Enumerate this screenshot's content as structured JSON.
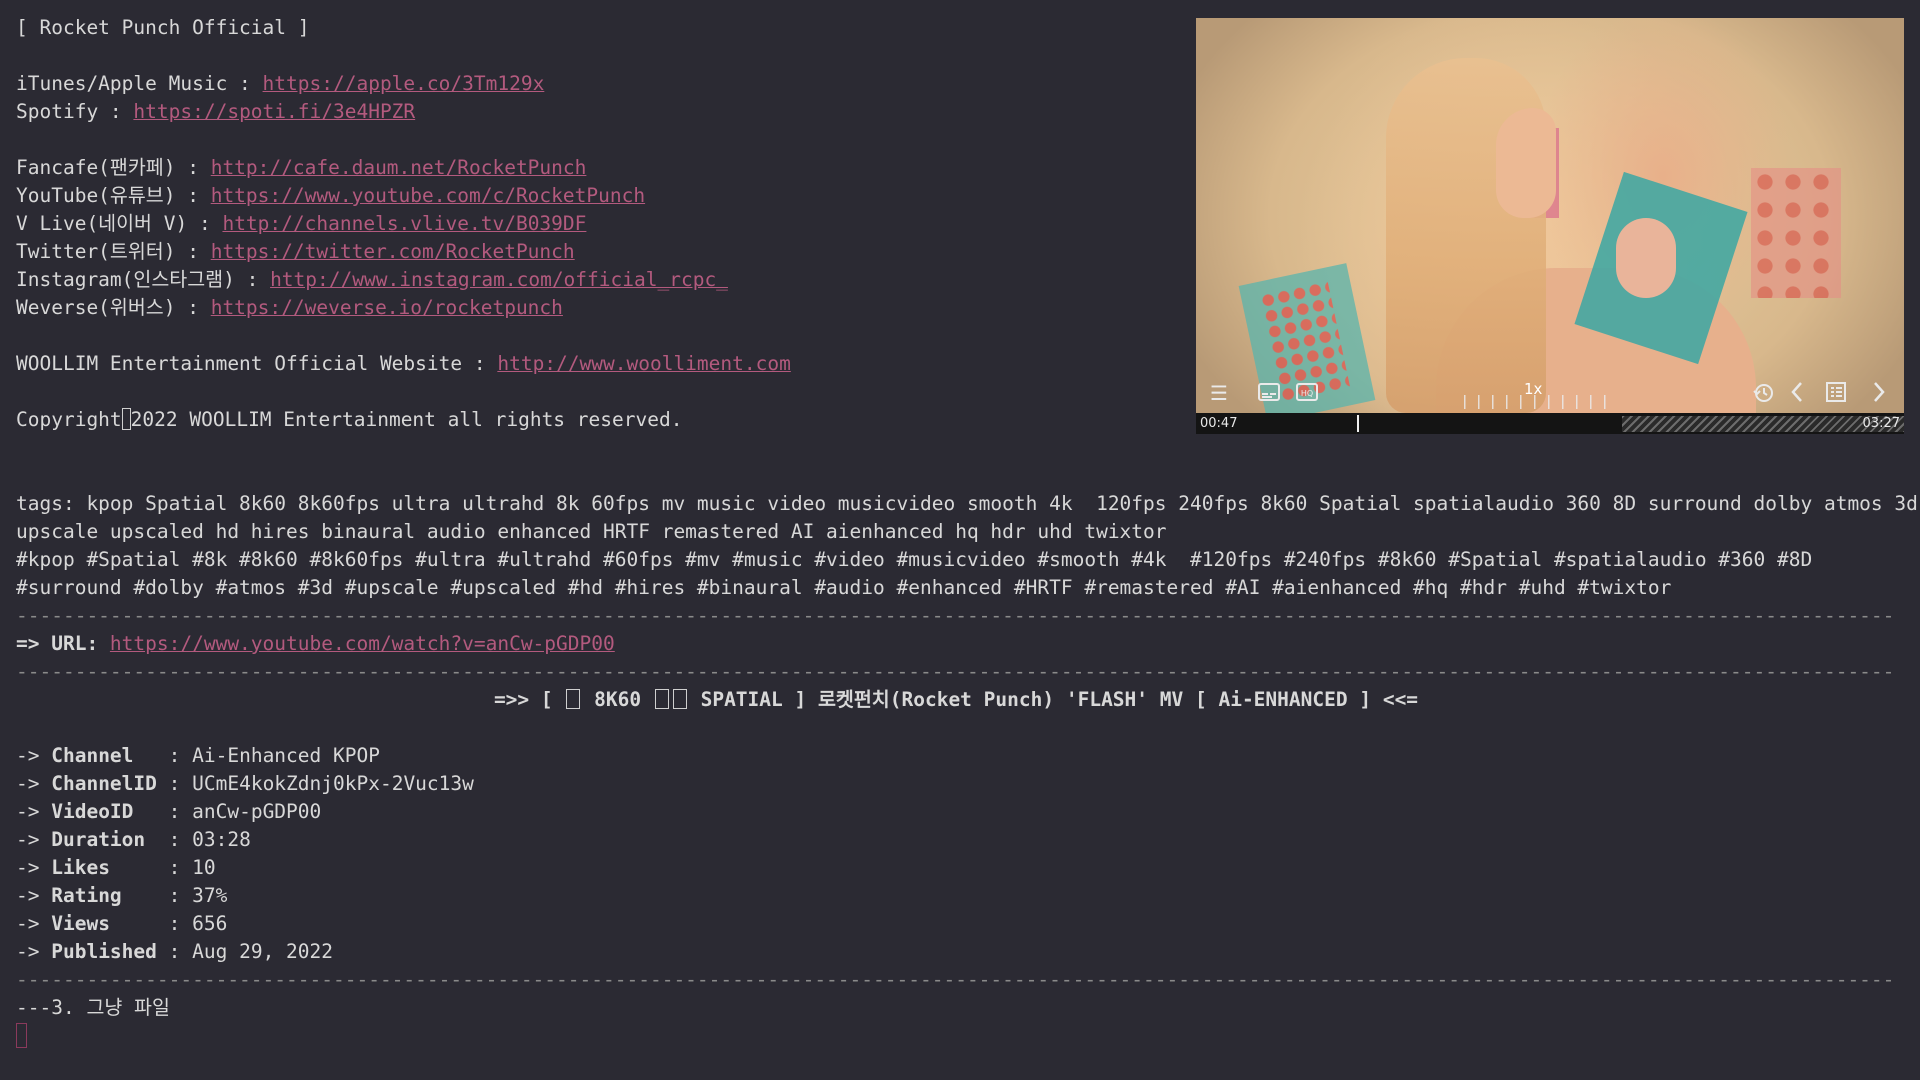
{
  "header": {
    "title": "[ Rocket Punch Official ]"
  },
  "music_links": [
    {
      "label": "iTunes/Apple Music : ",
      "url": "https://apple.co/3Tm129x"
    },
    {
      "label": "Spotify : ",
      "url": "https://spoti.fi/3e4HPZR"
    }
  ],
  "social_links": [
    {
      "label": "Fancafe(팬카페) : ",
      "url": "http://cafe.daum.net/RocketPunch"
    },
    {
      "label": "YouTube(유튜브) : ",
      "url": "https://www.youtube.com/c/RocketPunch"
    },
    {
      "label": "V Live(네이버 V) : ",
      "url": "http://channels.vlive.tv/B039DF"
    },
    {
      "label": "Twitter(트위터) : ",
      "url": "https://twitter.com/RocketPunch"
    },
    {
      "label": "Instagram(인스타그램) : ",
      "url": "http://www.instagram.com/official_rcpc_"
    },
    {
      "label": "Weverse(위버스) : ",
      "url": "https://weverse.io/rocketpunch"
    }
  ],
  "website": {
    "label": "WOOLLIM Entertainment Official Website : ",
    "url": "http://www.woolliment.com"
  },
  "copyright": {
    "pre": "Copyright",
    "post": "2022 WOOLLIM Entertainment all rights reserved."
  },
  "tags": {
    "line1": "tags: kpop Spatial 8k60 8k60fps ultra ultrahd 8k 60fps mv music video musicvideo smooth 4k  120fps 240fps 8k60 Spatial spatialaudio 360 8D surround dolby atmos 3d",
    "line2": "upscale upscaled hd hires binaural audio enhanced HRTF remastered AI aienhanced hq hdr uhd twixtor",
    "line3": "#kpop #Spatial #8k #8k60 #8k60fps #ultra #ultrahd #60fps #mv #music #video #musicvideo #smooth #4k  #120fps #240fps #8k60 #Spatial #spatialaudio #360 #8D",
    "line4": "#surround #dolby #atmos #3d #upscale #upscaled #hd #hires #binaural #audio #enhanced #HRTF #remastered #AI #aienhanced #hq #hdr #uhd #twixtor"
  },
  "separator": "---------------------------------------------------------------------------------------------------------------------------------------------------------------------------------------",
  "url_line": {
    "label": "=> URL: ",
    "url": "https://www.youtube.com/watch?v=anCw-pGDP00"
  },
  "title_line": {
    "prefix": "=>> [ ",
    "part1": " 8K60 ",
    "part2": " SPATIAL ] 로켓펀치(Rocket Punch) 'FLASH' MV [ Ai-ENHANCED ] <<="
  },
  "metadata": [
    {
      "key": "Channel   ",
      "value": "Ai-Enhanced KPOP"
    },
    {
      "key": "ChannelID ",
      "value": "UCmE4kokZdnj0kPx-2Vuc13w"
    },
    {
      "key": "VideoID   ",
      "value": "anCw-pGDP00"
    },
    {
      "key": "Duration  ",
      "value": "03:28"
    },
    {
      "key": "Likes     ",
      "value": "10"
    },
    {
      "key": "Rating    ",
      "value": "37%"
    },
    {
      "key": "Views     ",
      "value": "656"
    },
    {
      "key": "Published ",
      "value": "Aug 29, 2022"
    }
  ],
  "meta_arrow": "-> ",
  "meta_sep": ": ",
  "footer_line": "---3. 그냥 파일",
  "player": {
    "speed": "1x",
    "current_time": "00:47",
    "total_time": "03:27",
    "progress_fraction": 0.227,
    "icons": [
      "menu-icon",
      "subtitles-icon",
      "hq-icon",
      "history-icon",
      "prev-icon",
      "playlist-icon",
      "next-icon"
    ]
  },
  "colors": {
    "background": "#2b2a33",
    "text": "#d8d8d8",
    "link": "#b35a7e"
  }
}
